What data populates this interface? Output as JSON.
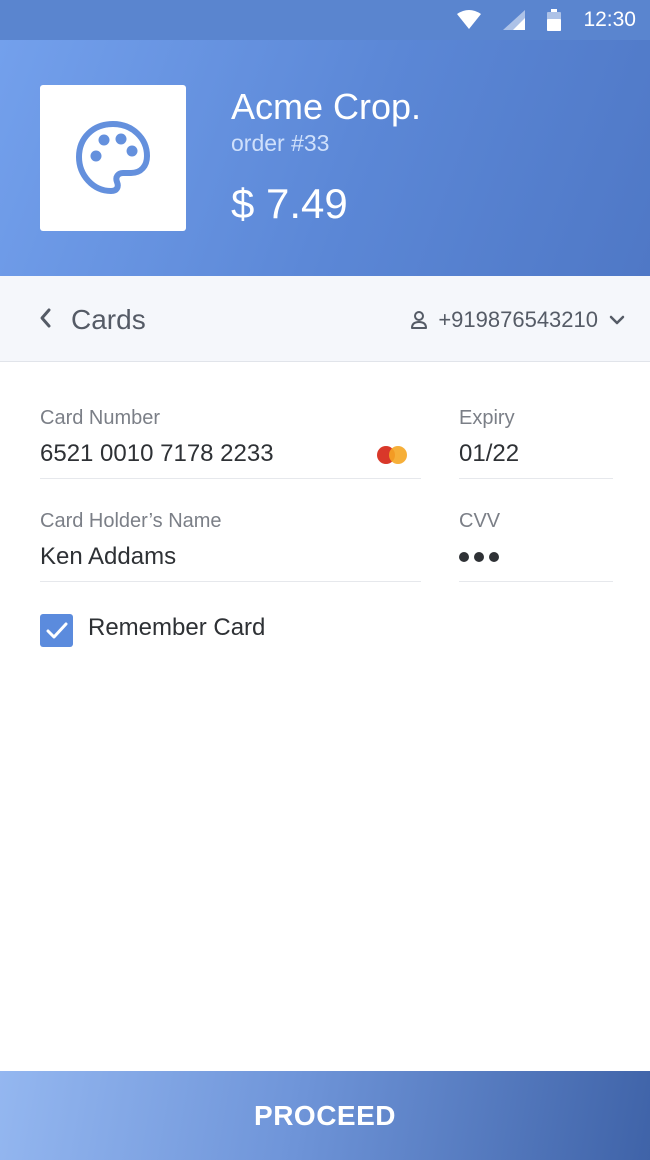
{
  "status_bar": {
    "time": "12:30",
    "icons": [
      "wifi-icon",
      "signal-icon",
      "battery-icon"
    ]
  },
  "header": {
    "logo_icon": "palette-icon",
    "merchant_name": "Acme Crop.",
    "order_id": "order #33",
    "amount": "$ 7.49"
  },
  "subnav": {
    "back_icon": "chevron-left-icon",
    "title": "Cards",
    "phone_icon": "user-icon",
    "phone_number": "+919876543210",
    "dropdown_icon": "chevron-down-icon"
  },
  "form": {
    "card_number": {
      "label": "Card Number",
      "value": "6521 0010 7178 2233",
      "brand_icon": "mastercard-icon"
    },
    "expiry": {
      "label": "Expiry",
      "value": "01/22"
    },
    "holder_name": {
      "label": "Card Holder’s Name",
      "value": "Ken Addams"
    },
    "cvv": {
      "label": "CVV",
      "masked_length": 3
    },
    "remember": {
      "label": "Remember Card",
      "checked": true
    }
  },
  "proceed_button": {
    "label": "PROCEED"
  },
  "colors": {
    "header_start": "#73a0ec",
    "header_end": "#4f78c6",
    "accent": "#5b8bdd",
    "button_end": "#3f63a8"
  }
}
